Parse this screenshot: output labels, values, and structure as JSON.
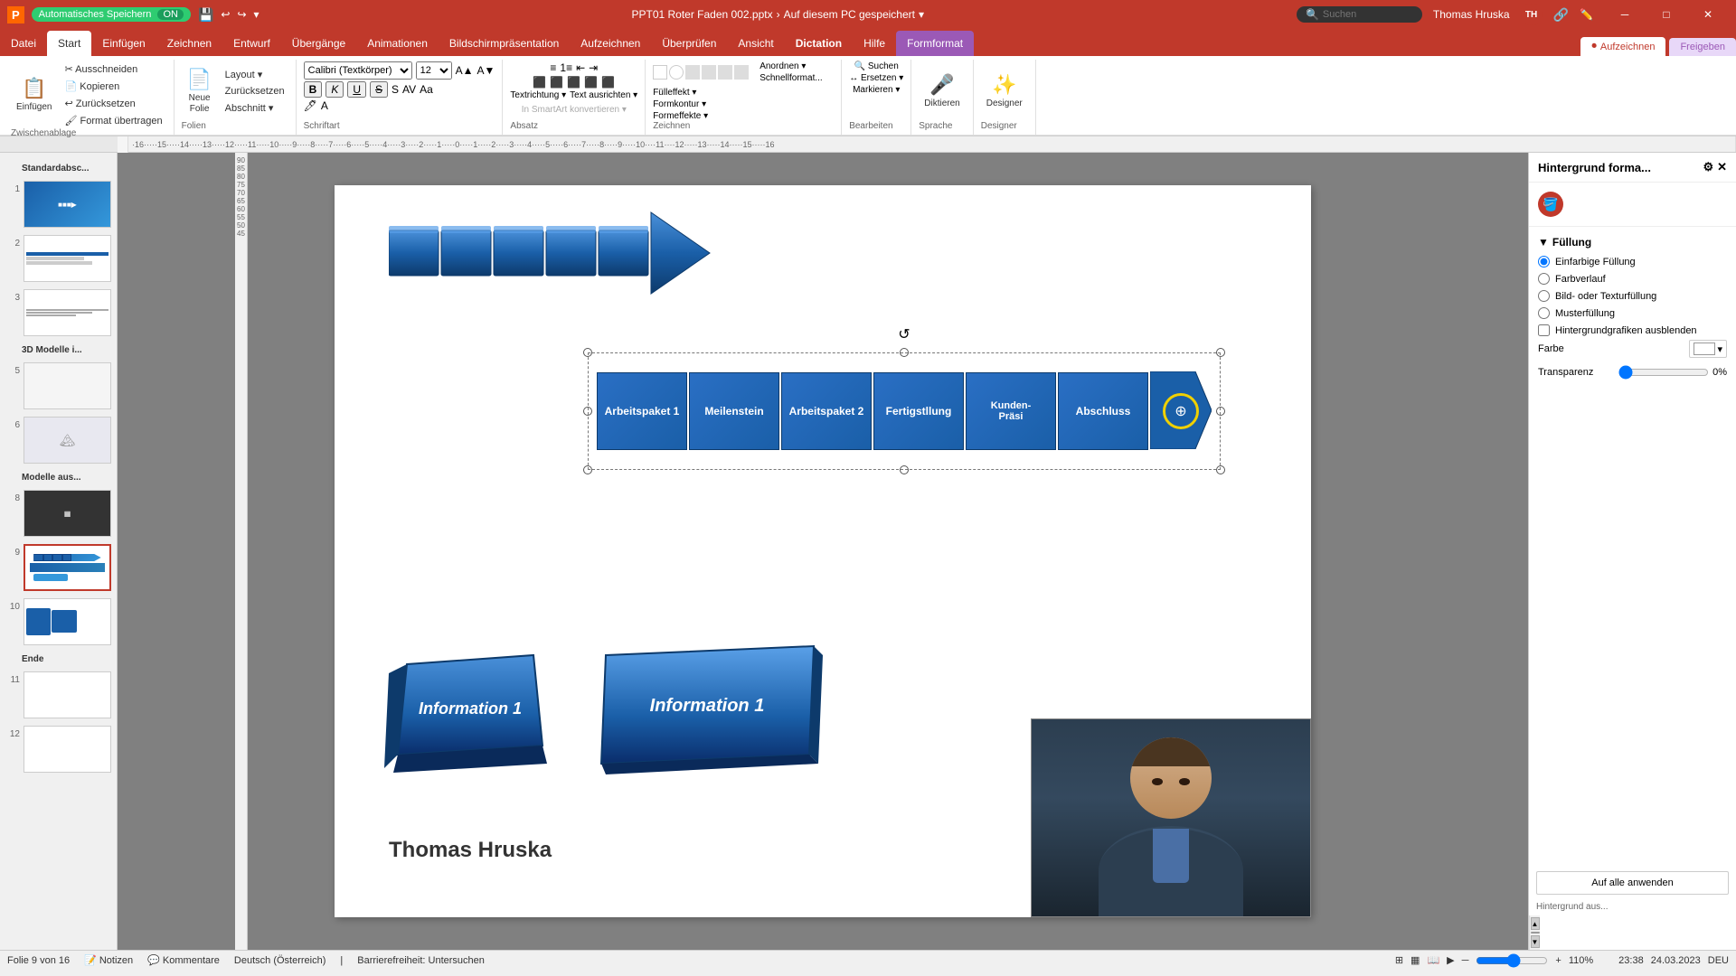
{
  "titlebar": {
    "autosave_label": "Automatisches Speichern",
    "autosave_state": "ON",
    "filename": "PPT01 Roter Faden 002.pptx",
    "location": "Auf diesem PC gespeichert",
    "search_placeholder": "Suchen",
    "user_name": "Thomas Hruska",
    "user_initials": "TH",
    "window_minimize": "─",
    "window_maximize": "□",
    "window_close": "✕"
  },
  "ribbon": {
    "tabs": [
      {
        "id": "datei",
        "label": "Datei"
      },
      {
        "id": "start",
        "label": "Start",
        "active": true
      },
      {
        "id": "einfuegen",
        "label": "Einfügen"
      },
      {
        "id": "zeichnen",
        "label": "Zeichnen"
      },
      {
        "id": "entwurf",
        "label": "Entwurf"
      },
      {
        "id": "uebergaenge",
        "label": "Übergänge"
      },
      {
        "id": "animationen",
        "label": "Animationen"
      },
      {
        "id": "bildschirmpraesentation",
        "label": "Bildschirmpräsentation"
      },
      {
        "id": "aufzeichnen",
        "label": "Aufzeichnen"
      },
      {
        "id": "ueberpruefen",
        "label": "Überprüfen"
      },
      {
        "id": "ansicht",
        "label": "Ansicht"
      },
      {
        "id": "dictation",
        "label": "Dictation"
      },
      {
        "id": "hilfe",
        "label": "Hilfe"
      },
      {
        "id": "formformat",
        "label": "Formformat",
        "highlight": true
      }
    ],
    "groups": {
      "zwischenablage": {
        "label": "Zwischenablage",
        "buttons": [
          "Ausschneiden",
          "Kopieren",
          "Zurücksetzen",
          "Format übertragen"
        ]
      },
      "folien": {
        "label": "Folien",
        "buttons": [
          "Neue Folie",
          "Layout",
          "Zurücksetzen",
          "Abschnitt"
        ]
      },
      "schriftart": {
        "label": "Schriftart",
        "font": "Calibri (Textkörper)",
        "size": "12"
      }
    },
    "aufzeichnen_btn": "Aufzeichnen",
    "freigeben_btn": "Freigeben",
    "diktieren_btn": "Diktieren",
    "designer_btn": "Designer"
  },
  "statusbar": {
    "slide_info": "Folie 9 von 16",
    "language": "Deutsch (Österreich)",
    "accessibility": "Barrierefreiheit: Untersuchen",
    "zoom": "110%",
    "time": "23:38",
    "date": "24.03.2023"
  },
  "slide_panel": {
    "groups": [
      {
        "label": "Standardabsc...",
        "number": ""
      },
      {
        "number": "1",
        "type": "blue"
      },
      {
        "number": "2",
        "type": "mixed"
      },
      {
        "number": "3",
        "type": "text"
      },
      {
        "label": "3D Modelle i...",
        "number": ""
      },
      {
        "number": "5",
        "type": "blank"
      },
      {
        "number": "6",
        "type": "3d"
      },
      {
        "label": "Modelle aus...",
        "number": ""
      },
      {
        "number": "8",
        "type": "dark"
      },
      {
        "number": "9",
        "type": "active"
      },
      {
        "number": "10",
        "type": "text2"
      },
      {
        "label": "Ende",
        "number": ""
      },
      {
        "number": "11",
        "type": "blank"
      },
      {
        "number": "12",
        "type": "blank2"
      }
    ]
  },
  "slide": {
    "process_items": [
      {
        "id": "ap1",
        "label": "Arbeitspaket 1"
      },
      {
        "id": "ms",
        "label": "Meilenstein"
      },
      {
        "id": "ap2",
        "label": "Arbeitspaket 2"
      },
      {
        "id": "fert",
        "label": "Fertigstllung"
      },
      {
        "id": "kund",
        "label": "Kunden-\nPräsi"
      },
      {
        "id": "abschl",
        "label": "Abschluss"
      }
    ],
    "info1_label": "Information 1",
    "info1_label2": "Information 1",
    "author": "Thomas Hruska"
  },
  "right_panel": {
    "title": "Hintergrund forma...",
    "section_label": "Füllung",
    "fill_options": [
      {
        "id": "einfach",
        "label": "Einfarbige Füllung",
        "checked": true
      },
      {
        "id": "farbverlauf",
        "label": "Farbverlauf",
        "checked": false
      },
      {
        "id": "bild",
        "label": "Bild- oder Texturfüllung",
        "checked": false
      },
      {
        "id": "muster",
        "label": "Musterfüllung",
        "checked": false
      },
      {
        "id": "hintergrund",
        "label": "Hintergrundgrafiken ausblenden",
        "checked": false
      }
    ],
    "farbe_label": "Farbe",
    "transparenz_label": "Transparenz",
    "transparenz_value": "0%",
    "apply_all_btn": "Auf alle anwenden",
    "hintergrund_label": "Hintergrund aus..."
  }
}
